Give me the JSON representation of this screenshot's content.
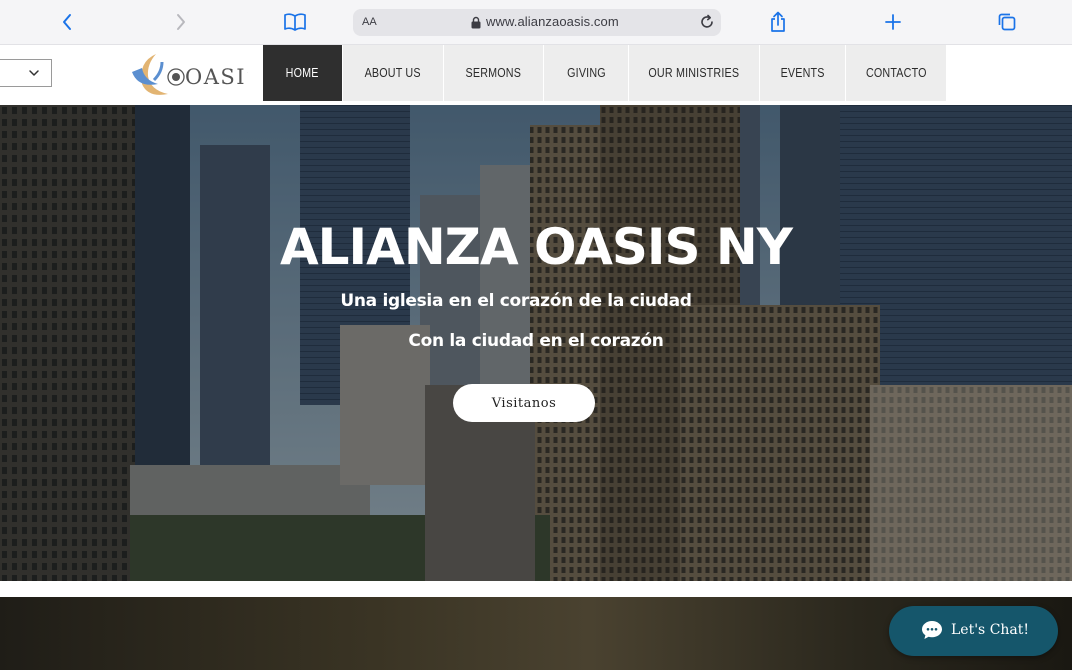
{
  "browser": {
    "text_size_label": "AA",
    "url": "www.alianzaoasis.com",
    "icons": [
      "back-icon",
      "forward-icon",
      "bookmarks-icon",
      "lock-icon",
      "reload-icon",
      "share-icon",
      "new-tab-icon",
      "tabs-icon"
    ]
  },
  "header": {
    "logo_text": "OASIS",
    "nav": [
      {
        "label": "HOME",
        "active": true
      },
      {
        "label": "ABOUT US"
      },
      {
        "label": "SERMONS"
      },
      {
        "label": "GIVING"
      },
      {
        "label": "OUR MINISTRIES"
      },
      {
        "label": "EVENTS"
      },
      {
        "label": "CONTACTO"
      }
    ]
  },
  "hero": {
    "title": "ALIANZA OASIS NY",
    "subtitle1": "Una iglesia en el corazón de la ciudad",
    "subtitle2": "Con la ciudad en el corazón",
    "button": "Visitanos"
  },
  "chat": {
    "label": "Let's Chat!"
  },
  "colors": {
    "nav_active_bg": "#2f2f2f",
    "nav_bg": "#ededed",
    "chat_bg": "#15566b",
    "logo_blue": "#5b8fd0",
    "logo_gold": "#e2b472"
  }
}
